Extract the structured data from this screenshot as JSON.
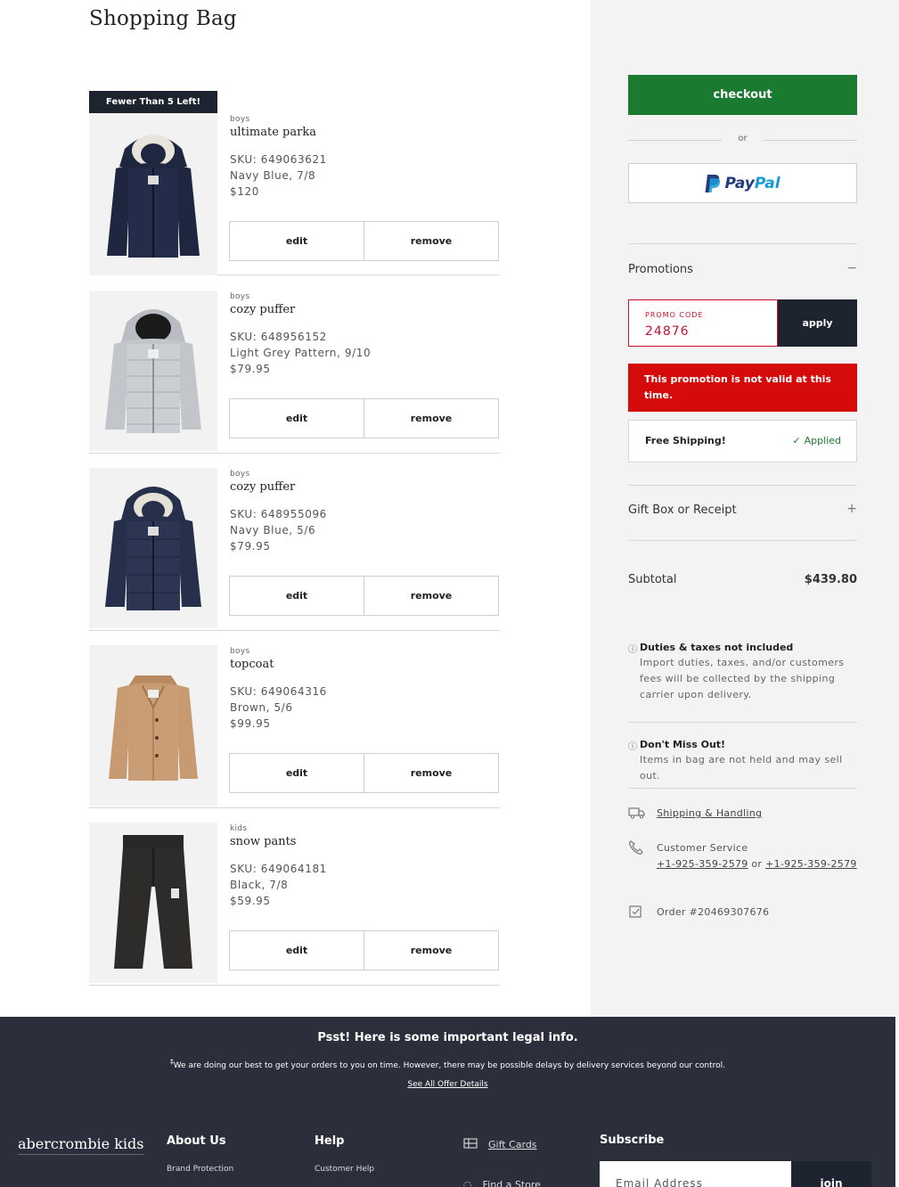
{
  "page": {
    "title": "Shopping Bag"
  },
  "cart": {
    "items": [
      {
        "badge": "Fewer Than 5 Left!",
        "category": "boys",
        "name": "ultimate parka",
        "sku": "SKU: 649063621",
        "variant": "Navy Blue, 7/8",
        "price": "$120",
        "edit": "edit",
        "remove": "remove"
      },
      {
        "badge": "",
        "category": "boys",
        "name": "cozy puffer",
        "sku": "SKU: 648956152",
        "variant": "Light Grey Pattern, 9/10",
        "price": "$79.95",
        "edit": "edit",
        "remove": "remove"
      },
      {
        "badge": "",
        "category": "boys",
        "name": "cozy puffer",
        "sku": "SKU: 648955096",
        "variant": "Navy Blue, 5/6",
        "price": "$79.95",
        "edit": "edit",
        "remove": "remove"
      },
      {
        "badge": "",
        "category": "boys",
        "name": "topcoat",
        "sku": "SKU: 649064316",
        "variant": "Brown, 5/6",
        "price": "$99.95",
        "edit": "edit",
        "remove": "remove"
      },
      {
        "badge": "",
        "category": "kids",
        "name": "snow pants",
        "sku": "SKU: 649064181",
        "variant": "Black, 7/8",
        "price": "$59.95",
        "edit": "edit",
        "remove": "remove"
      }
    ]
  },
  "summary": {
    "checkout_label": "checkout",
    "or_label": "or",
    "paypal_label_a": "Pay",
    "paypal_label_b": "Pal",
    "promotions_title": "Promotions",
    "promotions_toggle": "−",
    "promo_code_label": "PROMO CODE",
    "promo_code_value": "24876",
    "apply_label": "apply",
    "promo_error": "This promotion is not valid at this time.",
    "free_shipping_label": "Free Shipping!",
    "free_shipping_status": "Applied",
    "gift_title": "Gift Box or Receipt",
    "gift_toggle": "+",
    "subtotal_label": "Subtotal",
    "subtotal_value": "$439.80",
    "duties_title": "Duties & taxes not included",
    "duties_body": "Import duties, taxes, and/or customers fees will be collected by the shipping carrier upon delivery.",
    "miss_title": "Don't Miss Out!",
    "miss_body": "Items in bag are not held and may sell out.",
    "shipping_link": "Shipping & Handling",
    "customer_service_label": "Customer Service",
    "phone_1": "+1-925-359-2579",
    "phone_or": "or",
    "phone_2": "+1-925-359-2579",
    "order_number": "Order #20469307676"
  },
  "footer": {
    "legal_title": "Psst! Here is some important legal info.",
    "legal_body": "We are doing our best to get your orders to you on time. However, there may be possible delays by delivery services beyond our control.",
    "legal_mark": "‡",
    "legal_link": "See All Offer Details",
    "brand": "abercrombie kids",
    "about_title": "About Us",
    "about_item": "Brand Protection",
    "help_title": "Help",
    "help_item": "Customer Help",
    "gift_cards": "Gift Cards",
    "find_store": "Find a Store",
    "subscribe_title": "Subscribe",
    "email_placeholder": "Email Address",
    "join_label": "join"
  },
  "colors": {
    "checkout_green": "#1a7a30",
    "error_red": "#d50a0a",
    "navy": "#1e2330",
    "footer_bg": "#2b2f3c",
    "paypal_dark": "#253b80",
    "paypal_light": "#179bd7"
  }
}
